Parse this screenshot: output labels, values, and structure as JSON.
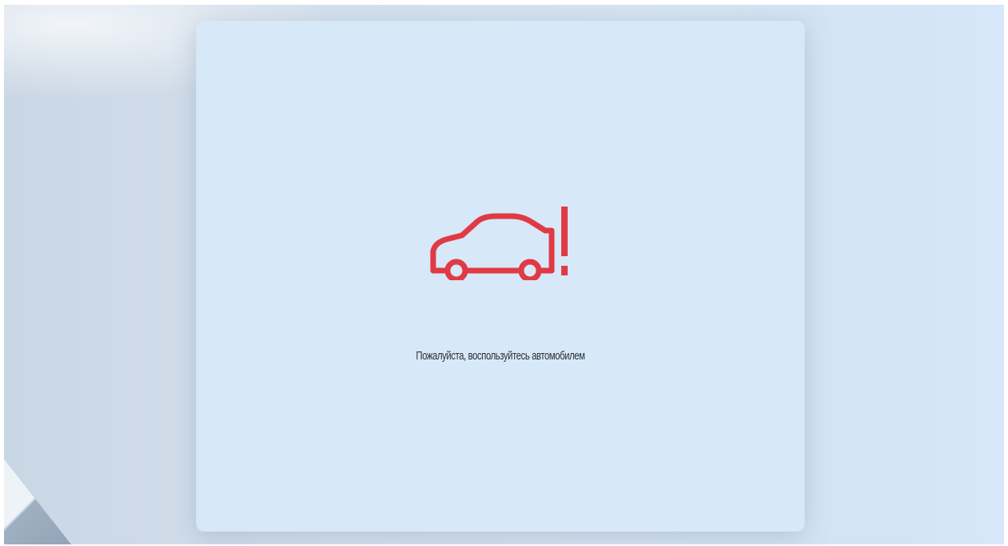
{
  "dialog": {
    "icon": "car-warning-icon",
    "message": "Пожалуйста, воспользуйтесь автомобилем"
  },
  "colors": {
    "accent": "#e03a45",
    "dialog_background": "#d7e8f8",
    "text": "#2a2f36"
  }
}
